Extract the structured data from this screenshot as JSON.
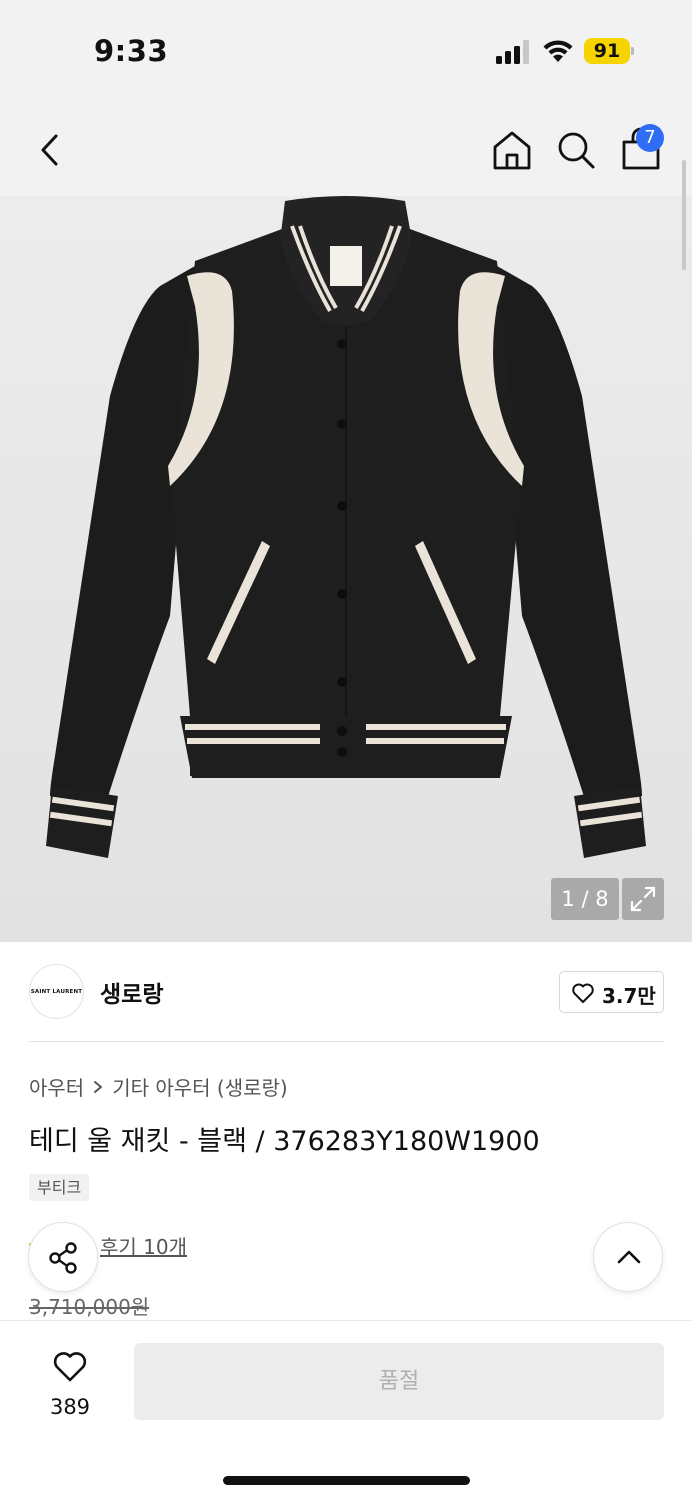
{
  "status_bar": {
    "time": "9:33",
    "battery": "91"
  },
  "header": {
    "icons": [
      "back-arrow-icon",
      "home-icon",
      "search-icon",
      "shopping-bag-icon"
    ],
    "cart_badge": "7"
  },
  "gallery": {
    "counter": "1 / 8",
    "expand_icon": "expand-icon"
  },
  "brand": {
    "logo_text": "SAINT LAURENT",
    "name": "생로랑",
    "favorite_count": "3.7만"
  },
  "product": {
    "breadcrumb": [
      "아우터",
      "기타 아우터 (생로랑)"
    ],
    "title": "테디 울 재킷 - 블랙 / 376283Y180W1900",
    "tag": "부티크",
    "review_link": "후기 10개",
    "original_price": "3,710,000원"
  },
  "bottom_bar": {
    "like_count": "389",
    "buy_button": "품절"
  },
  "colors": {
    "accent_badge": "#2f6df6",
    "battery": "#f5d400",
    "soldout_bg": "#ececec"
  }
}
